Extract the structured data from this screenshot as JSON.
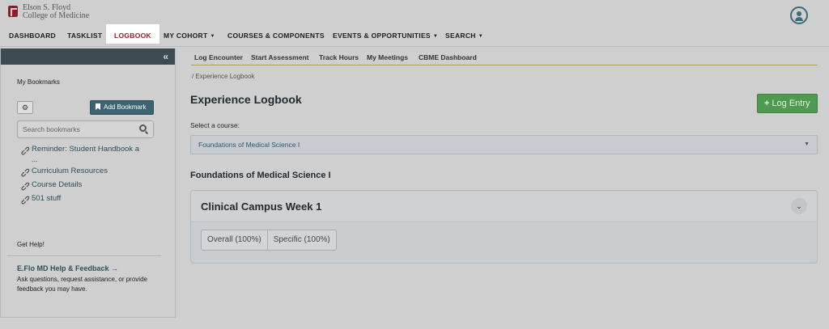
{
  "brand": {
    "line1": "Elson S. Floyd",
    "line2": "College of Medicine"
  },
  "main_nav": [
    {
      "label": "DASHBOARD",
      "caret": false
    },
    {
      "label": "TASKLIST",
      "caret": false
    },
    {
      "label": "LOGBOOK",
      "caret": false,
      "active": true
    },
    {
      "label": "MY COHORT",
      "caret": true
    },
    {
      "label": "COURSES & COMPONENTS",
      "caret": false
    },
    {
      "label": "EVENTS & OPPORTUNITIES",
      "caret": true
    },
    {
      "label": "SEARCH",
      "caret": true
    }
  ],
  "sidebar": {
    "title": "My Bookmarks",
    "add_bookmark": "Add Bookmark",
    "search_placeholder": "Search bookmarks",
    "bookmarks": [
      "Reminder: Student Handbook a",
      "Curriculum Resources",
      "Course Details",
      "501 stuff"
    ],
    "bookmark_continuation": "...",
    "help_title": "Get Help!",
    "help_link": "E.Flo MD Help & Feedback →",
    "help_text": "Ask questions, request assistance, or provide feedback you may have."
  },
  "sub_nav": [
    "Log Encounter",
    "Start Assessment",
    "Track Hours",
    "My Meetings",
    "CBME Dashboard"
  ],
  "breadcrumb": "/ Experience Logbook",
  "page_title": "Experience Logbook",
  "log_entry_label": "Log Entry",
  "select_label": "Select a course:",
  "selected_course": "Foundations of Medical Science I",
  "section_title": "Foundations of Medical Science I",
  "card": {
    "title": "Clinical Campus Week 1",
    "pills": [
      "Overall (100%)",
      "Specific (100%)"
    ]
  },
  "colors": {
    "active_nav": "#9b1c2e",
    "primary": "#3c6470",
    "success": "#4f9a4f"
  }
}
